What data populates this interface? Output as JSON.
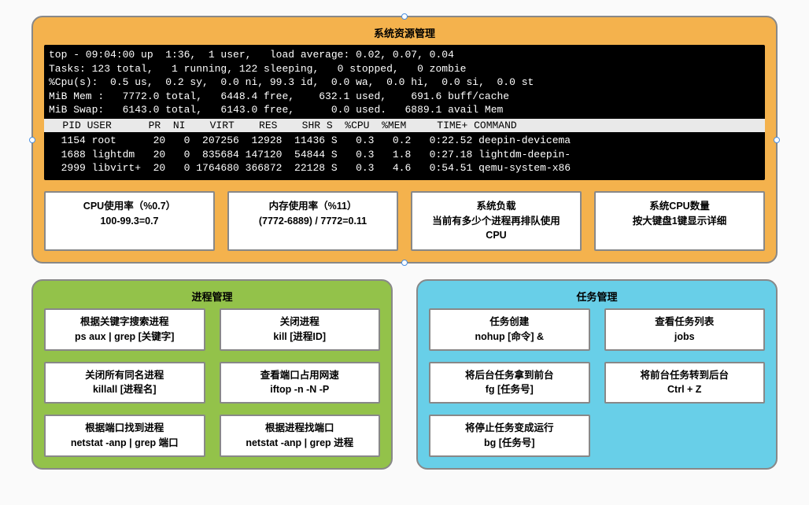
{
  "system": {
    "title": "系统资源管理",
    "terminal": {
      "line1": "top - 09:04:00 up  1:36,  1 user,   load average: 0.02, 0.07, 0.04",
      "line2": "Tasks: 123 total,   1 running, 122 sleeping,   0 stopped,   0 zombie",
      "line3": "%Cpu(s):  0.5 us,  0.2 sy,  0.0 ni, 99.3 id,  0.0 wa,  0.0 hi,  0.0 si,  0.0 st",
      "line4": "MiB Mem :   7772.0 total,   6448.4 free,    632.1 used,    691.6 buff/cache",
      "line5": "MiB Swap:   6143.0 total,   6143.0 free,      0.0 used.   6889.1 avail Mem",
      "header": "   PID USER      PR  NI    VIRT    RES    SHR S  %CPU  %MEM     TIME+ COMMAND",
      "rows": [
        "  1154 root      20   0  207256  12928  11436 S   0.3   0.2   0:22.52 deepin-devicema",
        "  1688 lightdm   20   0  835684 147120  54844 S   0.3   1.8   0:27.18 lightdm-deepin-",
        "  2999 libvirt+  20   0 1764680 366872  22128 S   0.3   4.6   0:54.51 qemu-system-x86"
      ]
    },
    "cards": [
      {
        "l1": "CPU使用率（%0.7）",
        "l2": "100-99.3=0.7"
      },
      {
        "l1": "内存使用率（%11）",
        "l2": "(7772-6889) / 7772=0.11"
      },
      {
        "l1": "系统负载",
        "l2": "当前有多少个进程再排队使用",
        "l3": "CPU"
      },
      {
        "l1": "系统CPU数量",
        "l2": "按大键盘1键显示详细"
      }
    ]
  },
  "process": {
    "title": "进程管理",
    "items": [
      {
        "label": "根据关键字搜索进程",
        "cmd": "ps aux | grep [关键字]"
      },
      {
        "label": "关闭进程",
        "cmd": "kill [进程ID]"
      },
      {
        "label": "关闭所有同名进程",
        "cmd": "killall [进程名]"
      },
      {
        "label": "查看端口占用网速",
        "cmd": "iftop -n -N -P"
      },
      {
        "label": "根据端口找到进程",
        "cmd": "netstat -anp | grep 端口"
      },
      {
        "label": "根据进程找端口",
        "cmd": "netstat -anp | grep 进程"
      }
    ]
  },
  "task": {
    "title": "任务管理",
    "items": [
      {
        "label": "任务创建",
        "cmd": "nohup [命令] &"
      },
      {
        "label": "查看任务列表",
        "cmd": "jobs"
      },
      {
        "label": "将后台任务拿到前台",
        "cmd": "fg [任务号]"
      },
      {
        "label": "将前台任务转到后台",
        "cmd": "Ctrl + Z"
      },
      {
        "label": "将停止任务变成运行",
        "cmd": "bg [任务号]"
      }
    ]
  }
}
